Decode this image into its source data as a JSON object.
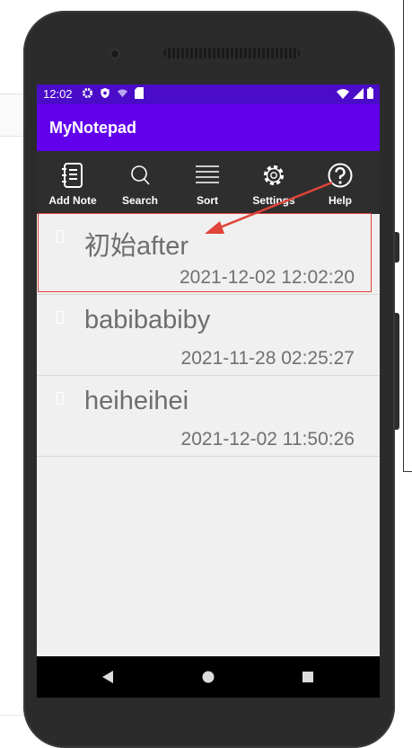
{
  "status_bar": {
    "time": "12:02",
    "left_icons": [
      "gear-icon",
      "shield-icon",
      "wifi-question-icon",
      "sim-card-icon"
    ],
    "right_icons": [
      "wifi-icon",
      "signal-icon",
      "battery-icon"
    ]
  },
  "app_bar": {
    "title": "MyNotepad"
  },
  "toolbar": {
    "items": [
      {
        "label": "Add Note",
        "icon": "notebook-icon"
      },
      {
        "label": "Search",
        "icon": "search-icon"
      },
      {
        "label": "Sort",
        "icon": "sort-lines-icon"
      },
      {
        "label": "Settings",
        "icon": "gear-icon"
      },
      {
        "label": "Help",
        "icon": "help-icon"
      }
    ]
  },
  "notes": [
    {
      "title": "初始after",
      "date": "2021-12-02 12:02:20"
    },
    {
      "title": "babibabiby",
      "date": "2021-11-28 02:25:27"
    },
    {
      "title": "heiheihei",
      "date": "2021-12-02 11:50:26"
    }
  ],
  "nav_bar": {
    "icons": [
      "back-icon",
      "home-icon",
      "recents-icon"
    ]
  },
  "colors": {
    "status_bar": "#4a0cc8",
    "app_bar": "#6200ee",
    "toolbar": "#2e2e2e",
    "list_bg": "#f0f0f0",
    "annotation": "#e0443a"
  }
}
